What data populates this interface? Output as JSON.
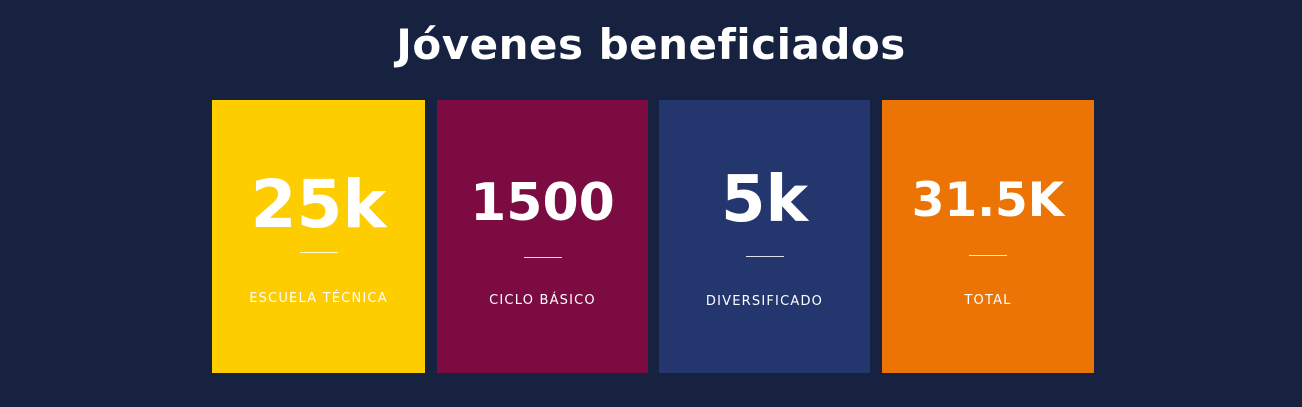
{
  "section": {
    "title": "Jóvenes beneficiados"
  },
  "colors": {
    "background": "#16223f",
    "text": "#ffffff"
  },
  "cards": [
    {
      "value": "25k",
      "label": "ESCUELA TÉCNICA",
      "color": "#fdcd00"
    },
    {
      "value": "1500",
      "label": "CICLO BÁSICO",
      "color": "#7c0b42"
    },
    {
      "value": "5k",
      "label": "DIVERSIFICADO",
      "color": "#23366e"
    },
    {
      "value": "31.5K",
      "label": "TOTAL",
      "color": "#eb7405"
    }
  ]
}
